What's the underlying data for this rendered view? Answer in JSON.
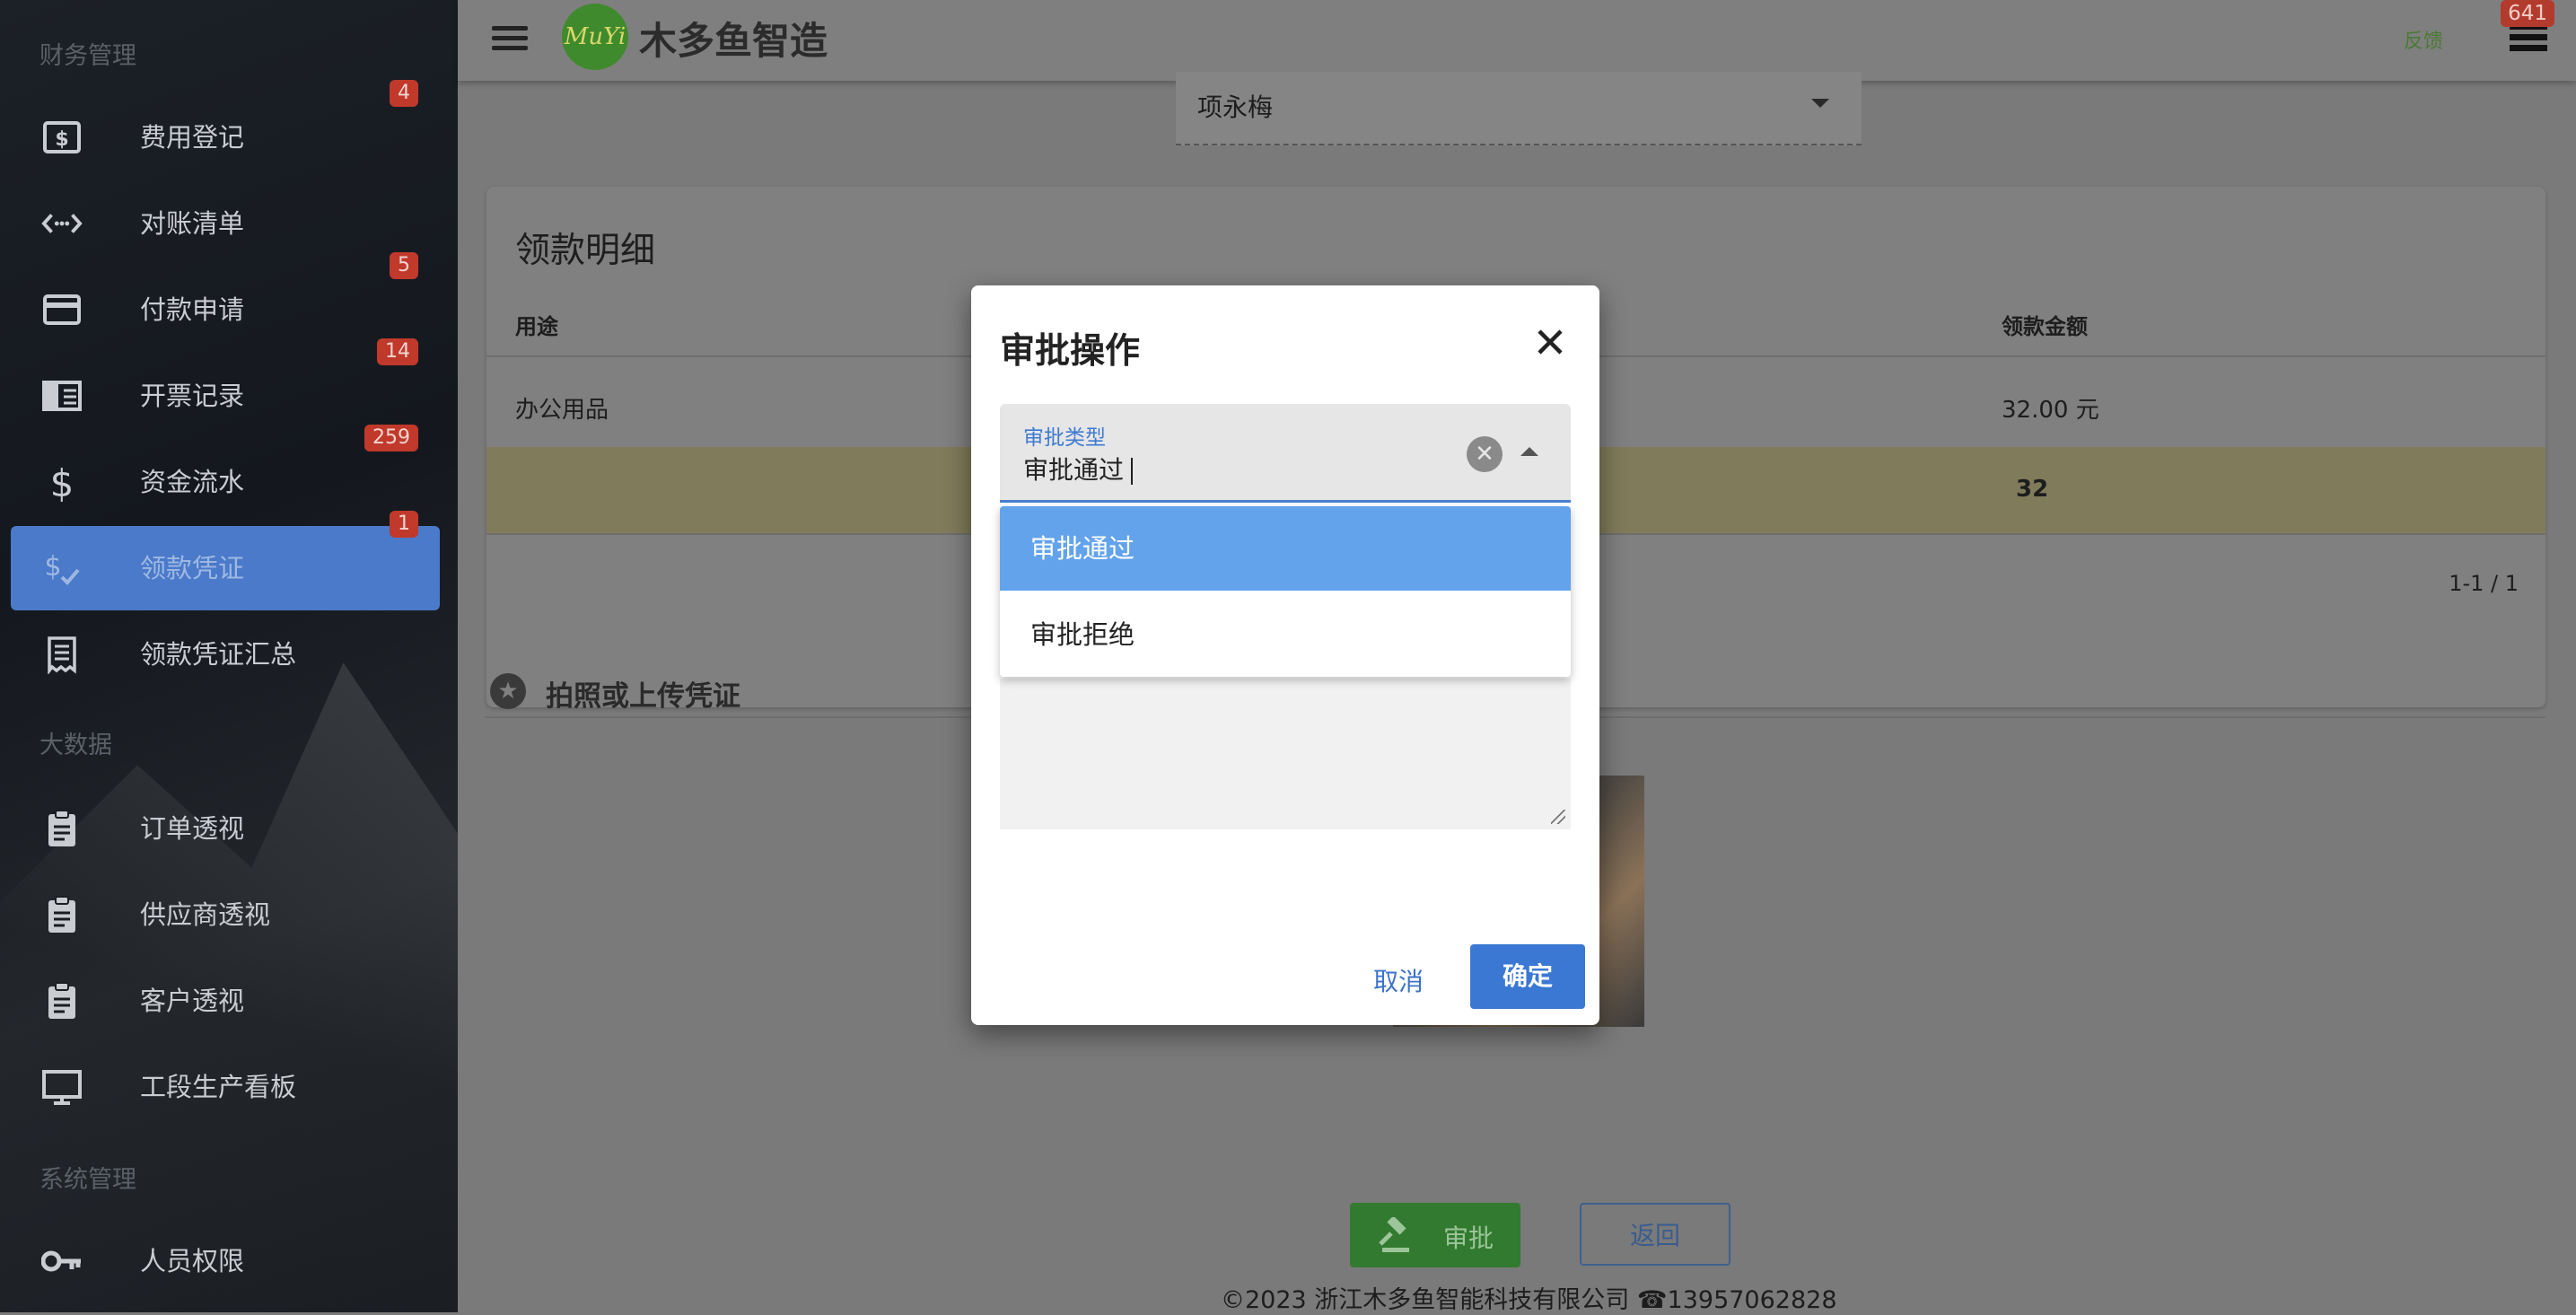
{
  "topbar": {
    "logo_text": "MuYi",
    "brand": "木多鱼智造",
    "feedback": "反馈",
    "notification_count": "641"
  },
  "sidebar": {
    "sections": [
      {
        "title": "财务管理",
        "items": [
          {
            "label": "费用登记",
            "badge": "4",
            "icon": "dollar-box-icon"
          },
          {
            "label": "对账清单",
            "badge": "",
            "icon": "code-arrows-icon"
          },
          {
            "label": "付款申请",
            "badge": "5",
            "icon": "credit-card-icon"
          },
          {
            "label": "开票记录",
            "badge": "14",
            "icon": "ledger-icon"
          },
          {
            "label": "资金流水",
            "badge": "259",
            "icon": "dollar-icon"
          },
          {
            "label": "领款凭证",
            "badge": "1",
            "icon": "dollar-check-icon",
            "active": true
          },
          {
            "label": "领款凭证汇总",
            "badge": "",
            "icon": "receipt-icon"
          }
        ]
      },
      {
        "title": "大数据",
        "items": [
          {
            "label": "订单透视",
            "icon": "clipboard-icon"
          },
          {
            "label": "供应商透视",
            "icon": "clipboard-icon"
          },
          {
            "label": "客户透视",
            "icon": "clipboard-icon"
          },
          {
            "label": "工段生产看板",
            "icon": "monitor-icon"
          }
        ]
      },
      {
        "title": "系统管理",
        "items": [
          {
            "label": "人员权限",
            "icon": "key-icon"
          }
        ]
      }
    ]
  },
  "main": {
    "approver_value": "项永梅",
    "card_title": "领款明细",
    "columns": [
      "用途",
      "领款金额"
    ],
    "rows": [
      {
        "purpose": "办公用品",
        "amount": "32.00 元"
      }
    ],
    "sum": "32",
    "pagination": "1-1 / 1",
    "upload_title": "拍照或上传凭证",
    "approve_label": "审批",
    "back_label": "返回",
    "footer": "©2023 浙江木多鱼智能科技有限公司",
    "footer_phone": "13957062828"
  },
  "dialog": {
    "title": "审批操作",
    "select_label": "审批类型",
    "select_value": "审批通过",
    "options": [
      "审批通过",
      "审批拒绝"
    ],
    "cancel": "取消",
    "ok": "确定"
  },
  "colors": {
    "accent": "#3b78d4",
    "badge": "#c0392b",
    "approve": "#327a2f",
    "selected_option": "#63a3ec"
  }
}
